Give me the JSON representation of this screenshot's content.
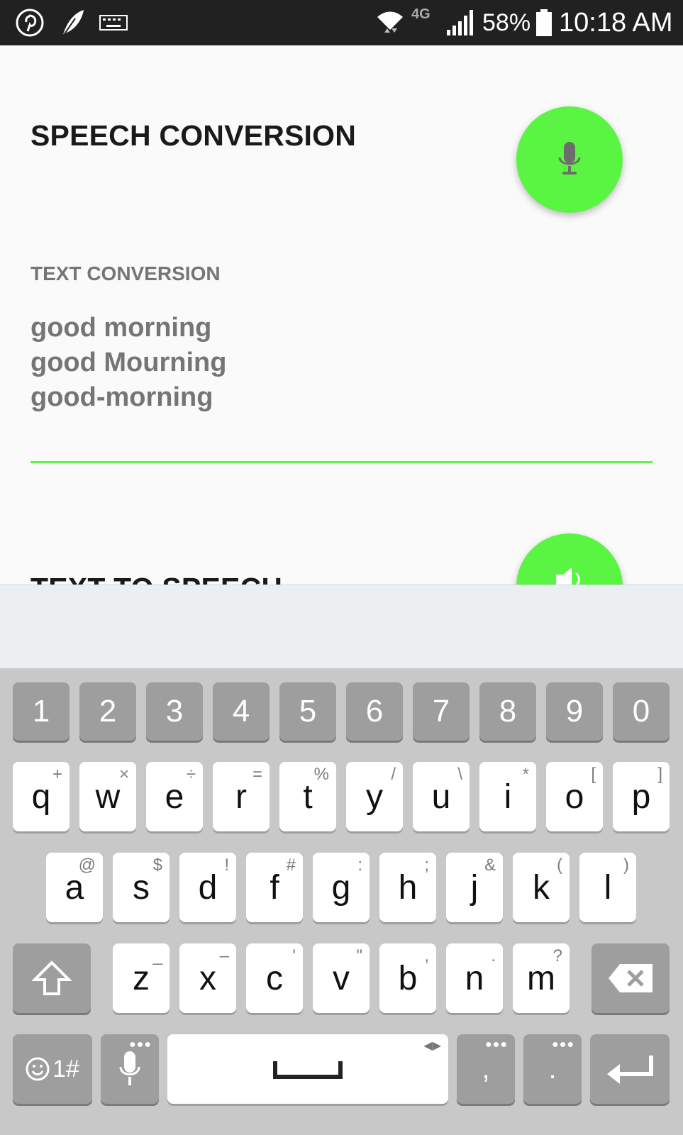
{
  "status_bar": {
    "battery_percent": "58%",
    "time": "10:18 AM",
    "network_label": "4G",
    "icons": [
      "pinterest-icon",
      "feather-icon",
      "keyboard-icon",
      "wifi-icon",
      "signal-icon",
      "battery-icon"
    ]
  },
  "app": {
    "speech_title": "SPEECH CONVERSION",
    "text_conversion_label": "TEXT CONVERSION",
    "results": [
      "good morning",
      "good Mourning",
      "good-morning"
    ],
    "tts_title": "TEXT TO SPEECH",
    "accent_color": "#5af542"
  },
  "keyboard": {
    "numbers": [
      "1",
      "2",
      "3",
      "4",
      "5",
      "6",
      "7",
      "8",
      "9",
      "0"
    ],
    "row1": [
      {
        "k": "q",
        "h": "+"
      },
      {
        "k": "w",
        "h": "×"
      },
      {
        "k": "e",
        "h": "÷"
      },
      {
        "k": "r",
        "h": "="
      },
      {
        "k": "t",
        "h": "%"
      },
      {
        "k": "y",
        "h": "/"
      },
      {
        "k": "u",
        "h": "\\"
      },
      {
        "k": "i",
        "h": "*"
      },
      {
        "k": "o",
        "h": "["
      },
      {
        "k": "p",
        "h": "]"
      }
    ],
    "row2": [
      {
        "k": "a",
        "h": "@"
      },
      {
        "k": "s",
        "h": "$"
      },
      {
        "k": "d",
        "h": "!"
      },
      {
        "k": "f",
        "h": "#"
      },
      {
        "k": "g",
        "h": ":"
      },
      {
        "k": "h",
        "h": ";"
      },
      {
        "k": "j",
        "h": "&"
      },
      {
        "k": "k",
        "h": "("
      },
      {
        "k": "l",
        "h": ")"
      }
    ],
    "row3": [
      {
        "k": "z",
        "h": "_"
      },
      {
        "k": "x",
        "h": "–"
      },
      {
        "k": "c",
        "h": "'"
      },
      {
        "k": "v",
        "h": "\""
      },
      {
        "k": "b",
        "h": ","
      },
      {
        "k": "n",
        "h": "."
      },
      {
        "k": "m",
        "h": "?"
      }
    ],
    "symbols_label": "1#",
    "comma": ",",
    "period": "."
  }
}
